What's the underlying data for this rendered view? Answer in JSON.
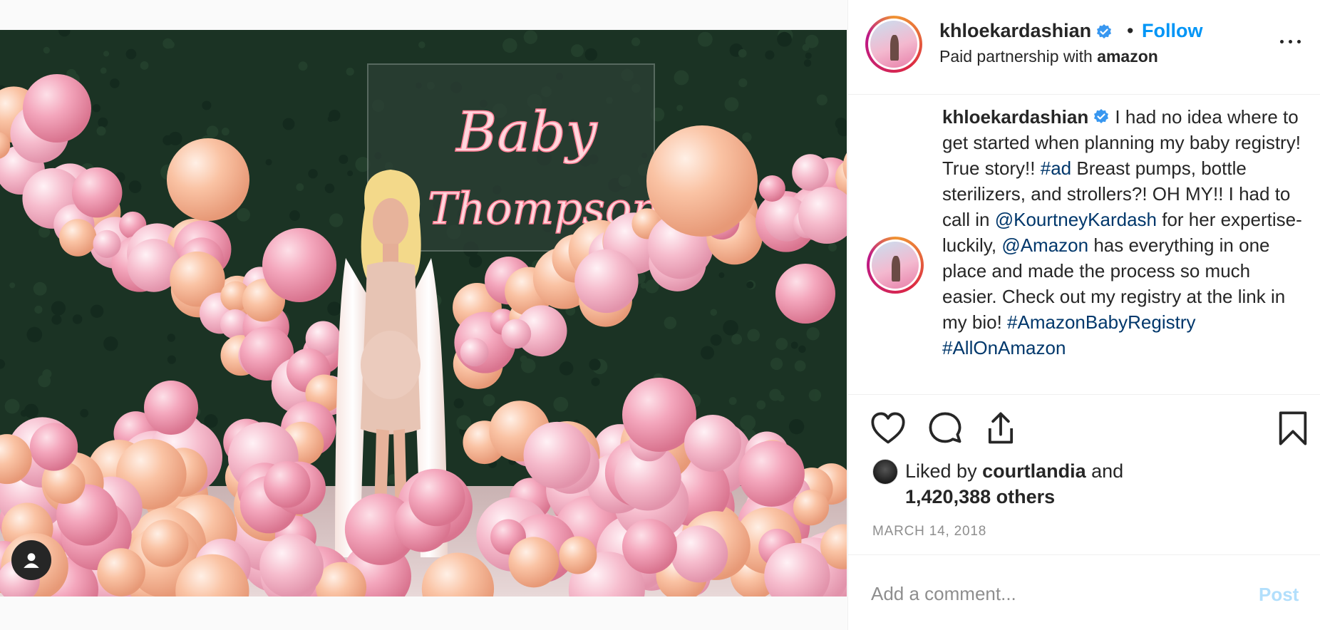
{
  "post": {
    "username": "khloekardashian",
    "separator": "•",
    "follow_label": "Follow",
    "paid_prefix": "Paid partnership with",
    "partner": "amazon",
    "neon_sign_line1": "Baby",
    "neon_sign_line2": "Thompson"
  },
  "caption": {
    "username": "khloekardashian",
    "text_1": " I had no idea where to get started when planning my baby registry! True story!! ",
    "tag_ad": "#ad",
    "text_2": " Breast pumps, bottle sterilizers, and strollers?! OH MY!! I had to call in ",
    "mention_kourtney": "@KourtneyKardash",
    "text_3": " for her expertise- luckily, ",
    "mention_amazon": "@Amazon",
    "text_4": " has everything in one place and made the process so much easier. Check out my registry at the link in my bio! ",
    "tag_registry": "#AmazonBabyRegistry",
    "text_5": " ",
    "tag_allon": "#AllOnAmazon"
  },
  "likes": {
    "prefix": "Liked by",
    "user": "courtlandia",
    "joiner": "and",
    "count_text": "1,420,388 others"
  },
  "date": "MARCH 14, 2018",
  "comment": {
    "placeholder": "Add a comment...",
    "post_label": "Post"
  },
  "colors": {
    "accent_blue": "#0095f6",
    "link_blue": "#00376b",
    "post_disabled": "#b2dffc",
    "muted": "#8e8e8e"
  },
  "icons": [
    "user-tag-icon",
    "verified-badge-icon",
    "more-options-icon",
    "heart-icon",
    "comment-icon",
    "share-icon",
    "bookmark-icon"
  ]
}
